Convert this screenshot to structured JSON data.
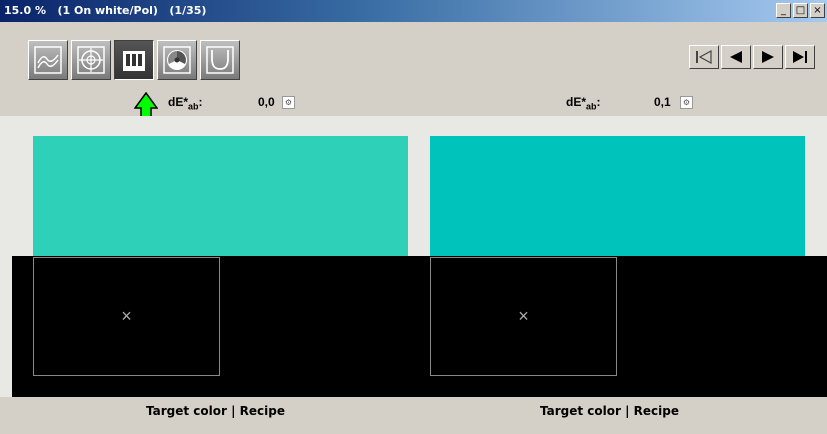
{
  "window": {
    "title": "15.0 %   (1 On white/Pol)   (1/35)",
    "minimize": "_",
    "maximize": "□",
    "close": "×"
  },
  "toolbar": {
    "view_buttons": [
      {
        "icon": "spectral-curve-icon"
      },
      {
        "icon": "crosshair-target-icon"
      },
      {
        "icon": "color-bars-icon",
        "active": true
      },
      {
        "icon": "color-wheel-icon"
      },
      {
        "icon": "goniometric-curve-icon"
      }
    ],
    "nav_buttons": [
      {
        "icon": "first-record-icon"
      },
      {
        "icon": "previous-record-icon"
      },
      {
        "icon": "next-record-icon"
      },
      {
        "icon": "last-record-icon"
      }
    ]
  },
  "panels": [
    {
      "de_label_main": "dE*",
      "de_label_sub": "ab",
      "de_label_colon": ":",
      "de_value": "0,0",
      "swatch_color": "#2ed1b8",
      "image_placeholder": "×",
      "caption": "Target color | Recipe"
    },
    {
      "de_label_main": "dE*",
      "de_label_sub": "ab",
      "de_label_colon": ":",
      "de_value": "0,1",
      "swatch_color": "#00c4bc",
      "image_placeholder": "×",
      "caption": "Target color | Recipe"
    }
  ],
  "colors": {
    "arrow": "#00ff00",
    "background": "#e8e8e4",
    "image_area": "#000000"
  }
}
